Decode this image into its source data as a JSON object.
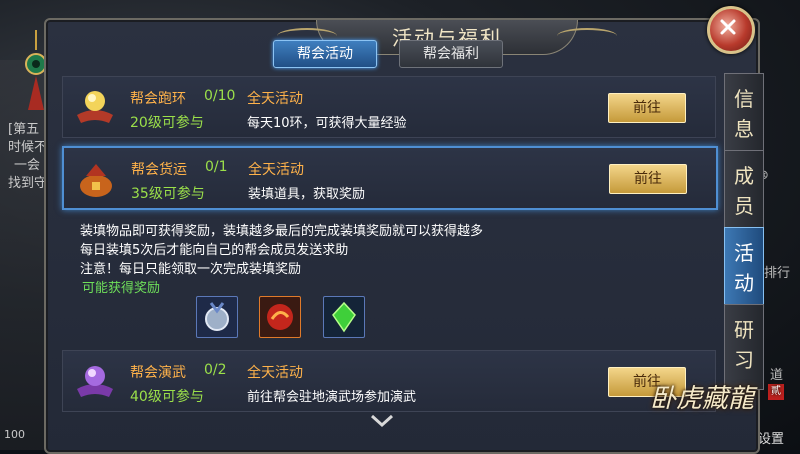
{
  "window": {
    "title": "活动与福利"
  },
  "tabs": [
    {
      "label": "帮会活动"
    },
    {
      "label": "帮会福利"
    }
  ],
  "side_tabs": [
    {
      "label": [
        "信",
        "息"
      ]
    },
    {
      "label": [
        "成",
        "员"
      ]
    },
    {
      "label": [
        "活",
        "动"
      ]
    },
    {
      "label": [
        "研",
        "习"
      ]
    }
  ],
  "activities": [
    {
      "name": "帮会跑环",
      "progress": "0/10",
      "time": "全天活动",
      "level": "20级可参与",
      "desc": "每天10环，可获得大量经验",
      "button": "前往"
    },
    {
      "name": "帮会货运",
      "progress": "0/1",
      "time": "全天活动",
      "level": "35级可参与",
      "desc": "装填道具，获取奖励",
      "button": "前往"
    },
    {
      "name": "帮会演武",
      "progress": "0/2",
      "time": "全天活动",
      "level": "40级可参与",
      "desc": "前往帮会驻地演武场参加演武",
      "button": "前往"
    }
  ],
  "detail": {
    "lines": [
      "装填物品即可获得奖励，装填越多最后的完成装填奖励就可以获得越多",
      "每日装填5次后才能向自己的帮会成员发送求助",
      "注意！每日只能领取一次完成装填奖励"
    ],
    "reward_label": "可能获得奖励"
  },
  "background": {
    "left_text": [
      "[第五",
      "时候不",
      "一会",
      "找到守"
    ],
    "bottom_number": "100",
    "setting_text": "设置",
    "right_text": [
      "排行",
      "道"
    ]
  },
  "logo": {
    "text": "卧虎藏龍",
    "seal": "貳"
  },
  "colors": {
    "accent_blue": "#4f8fd3",
    "orange": "#ffb24a",
    "green": "#9be04a",
    "gold_button": "#f3d58a"
  }
}
